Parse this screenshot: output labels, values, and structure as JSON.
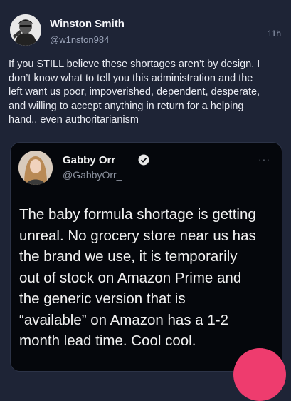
{
  "post": {
    "author_name": "Winston Smith",
    "author_handle": "@w1nston984",
    "timestamp": "11h",
    "text_lines": [
      "If you STILL believe these shortages aren’t by design, I",
      "don’t know what to tell you this administration and the",
      "left want us poor, impoverished, dependent, desperate,",
      "and willing to accept anything in return for a helping",
      "hand.. even authoritarianism"
    ]
  },
  "embedded_post": {
    "author_name": "Gabby Orr",
    "author_handle": "@GabbyOrr_",
    "more_label": "···",
    "text_lines": [
      "The baby formula shortage is getting",
      "unreal. No grocery store near us has",
      "the brand we use, it is temporarily",
      "out of stock on Amazon Prime and",
      "the generic version that is",
      "“available” on Amazon has a 1-2",
      "month lead time. Cool cool."
    ]
  },
  "icons": {
    "verified": "verified-badge-icon",
    "more": "more-options-icon"
  },
  "colors": {
    "background": "#1e2436",
    "embed_background": "#05070c",
    "accent_pink": "#ee3c6e"
  }
}
